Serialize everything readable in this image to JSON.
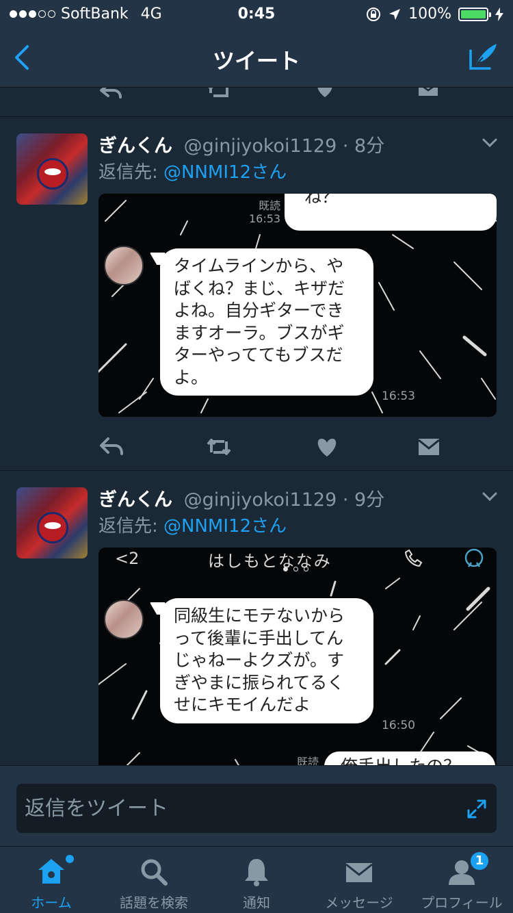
{
  "status_bar": {
    "carrier": "SoftBank",
    "network": "4G",
    "time": "0:45",
    "battery": "100%",
    "signal_bars_filled": 3,
    "signal_bars_total": 5
  },
  "nav": {
    "title": "ツイート",
    "back_icon": "chevron-left-icon",
    "compose_icon": "compose-tweet-icon"
  },
  "tweets": [
    {
      "name": "ぎんくん",
      "handle": "@ginjiyokoi1129",
      "time": "8分",
      "reply_label": "返信先:",
      "reply_mention": "@NNMI12さん",
      "media": {
        "read_label": "既読",
        "read_time": "16:53",
        "top_bubble_text": "ね？",
        "main_bubble_text": "タイムラインから、やばくね？まじ、キザだよね。自分ギターできますオーラ。ブスがギターやっててもブスだよ。",
        "main_time": "16:53"
      }
    },
    {
      "name": "ぎんくん",
      "handle": "@ginjiyokoi1129",
      "time": "9分",
      "reply_label": "返信先:",
      "reply_mention": "@NNMI12さん",
      "media": {
        "back_count": "2",
        "chat_name": "はしもとななみ",
        "main_bubble_text": "同級生にモテないからって後輩に手出してんじゃねーよクズが。すぎやまに振られてるくせにキモイんだよ",
        "main_time": "16:50",
        "read_label": "既読",
        "bottom_bubble_text": "俺手出したの？",
        "pager_count": 3,
        "pager_active": 1
      }
    }
  ],
  "actions": [
    "reply-icon",
    "retweet-icon",
    "like-icon",
    "dm-icon"
  ],
  "reply_bar": {
    "placeholder": "返信をツイート",
    "expand_icon": "expand-icon"
  },
  "tabs": [
    {
      "label": "ホーム",
      "icon": "home-icon",
      "active": true
    },
    {
      "label": "話題を検索",
      "icon": "search-icon",
      "active": false
    },
    {
      "label": "通知",
      "icon": "bell-icon",
      "active": false
    },
    {
      "label": "メッセージ",
      "icon": "mail-icon",
      "active": false
    },
    {
      "label": "プロフィール",
      "icon": "profile-icon",
      "active": false,
      "badge": "1"
    }
  ],
  "colors": {
    "background": "#141d26",
    "bar": "#243447",
    "card": "#1b2836",
    "accent": "#1da1f2",
    "muted": "#8899a6"
  }
}
